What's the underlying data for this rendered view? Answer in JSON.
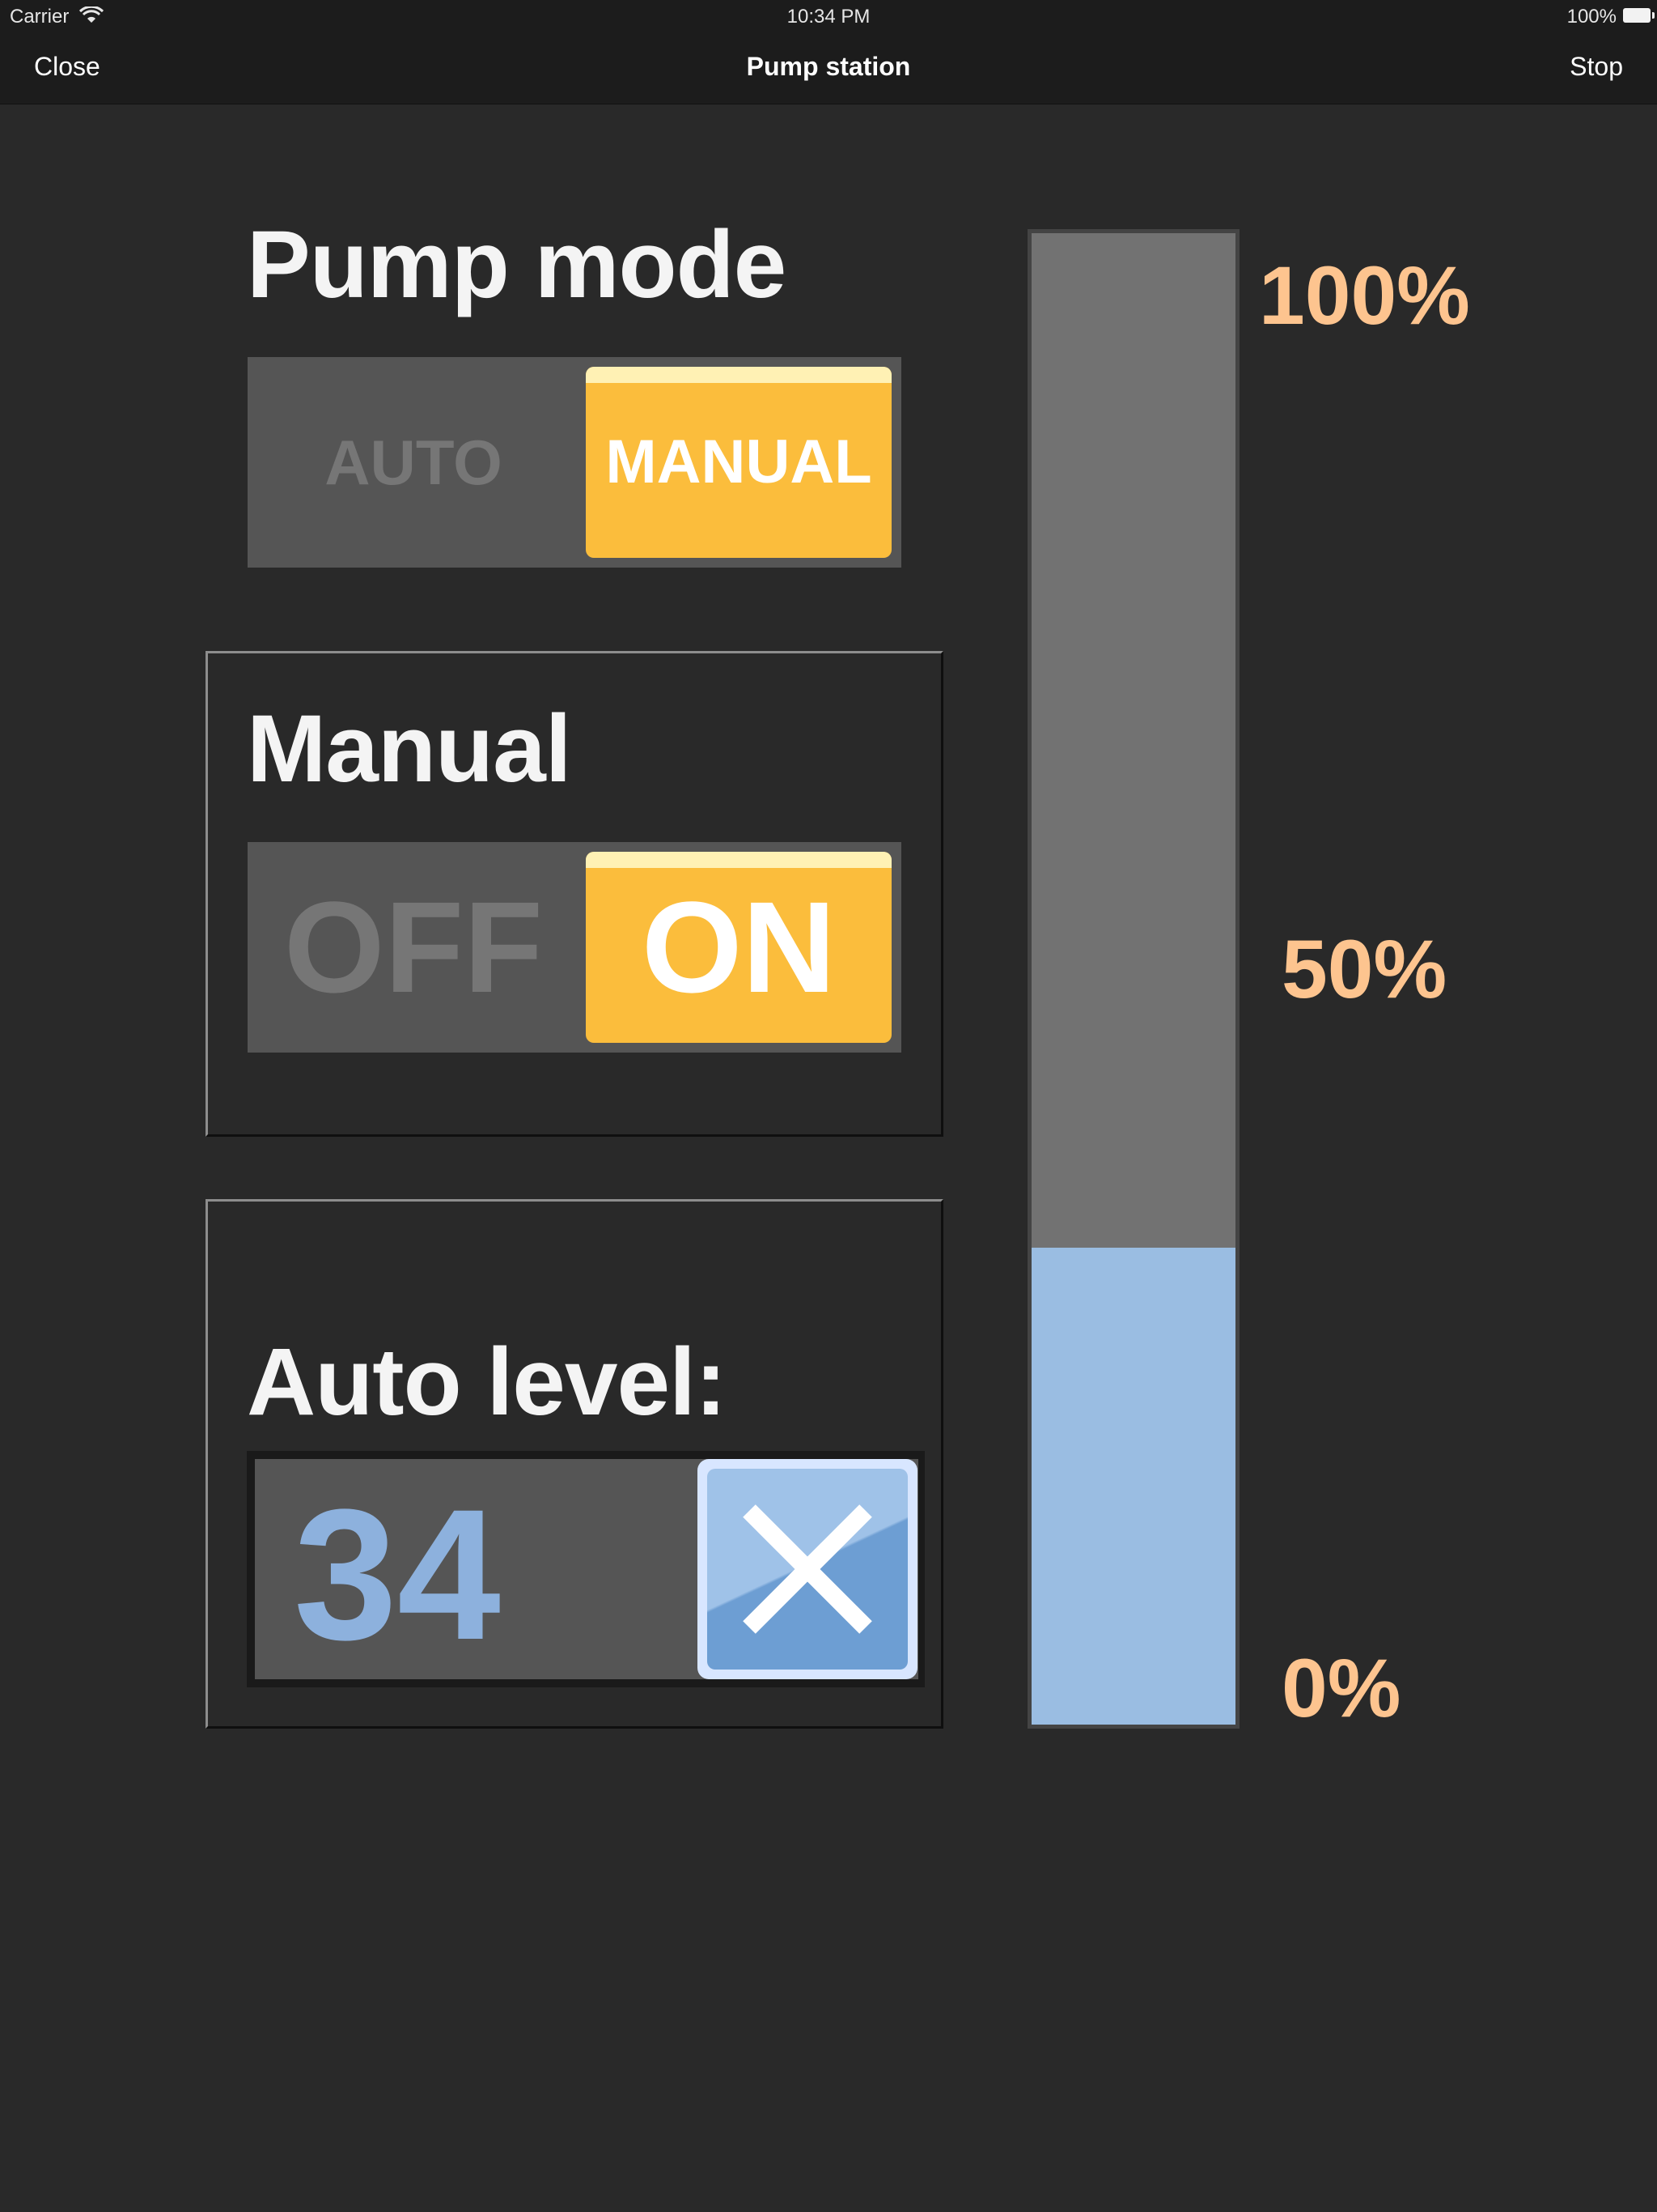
{
  "status_bar": {
    "carrier": "Carrier",
    "time": "10:34 PM",
    "battery": "100%"
  },
  "nav": {
    "left": "Close",
    "title": "Pump station",
    "right": "Stop"
  },
  "pump_mode": {
    "heading": "Pump mode",
    "options": [
      "AUTO",
      "MANUAL"
    ],
    "selected": "MANUAL"
  },
  "manual": {
    "heading": "Manual",
    "options": [
      "OFF",
      "ON"
    ],
    "selected": "ON"
  },
  "auto_level": {
    "heading": "Auto level:",
    "value": "34"
  },
  "tank": {
    "fill_fraction": 0.32,
    "labels": {
      "top": "100%",
      "middle": "50%",
      "bottom": "0%"
    }
  },
  "colors": {
    "background": "#292929",
    "accent": "#fbbd3c",
    "level": "#9abde2",
    "percent_text": "#fdc48f"
  }
}
